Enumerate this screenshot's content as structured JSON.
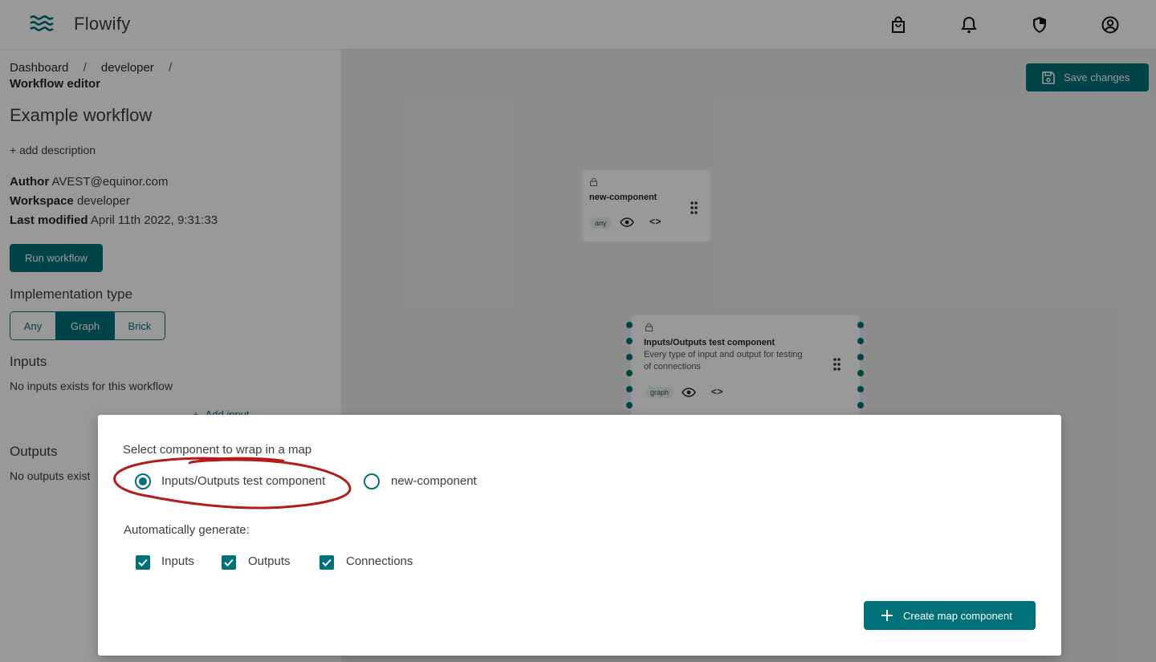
{
  "app": {
    "title": "Flowify"
  },
  "header": {
    "icons": [
      "shopping-bag-icon",
      "bell-icon",
      "shield-icon",
      "account-circle-icon"
    ]
  },
  "breadcrumb": {
    "items": [
      "Dashboard",
      "developer"
    ],
    "separator": "/",
    "current": "Workflow editor"
  },
  "workflow": {
    "title": "Example workflow",
    "add_description": "+ add description",
    "author_label": "Author",
    "author": "AVEST@equinor.com",
    "workspace_label": "Workspace",
    "workspace": "developer",
    "last_modified_label": "Last modified",
    "last_modified": "April 11th 2022, 9:31:33",
    "run_button": "Run workflow"
  },
  "implementation": {
    "title": "Implementation type",
    "options": [
      "Any",
      "Graph",
      "Brick"
    ],
    "selected": "Graph"
  },
  "inputs": {
    "title": "Inputs",
    "empty_text": "No inputs exists for this workflow",
    "add_label": "Add input"
  },
  "outputs": {
    "title": "Outputs",
    "empty_text": "No outputs exist"
  },
  "canvas": {
    "save_button": "Save changes",
    "nodes": [
      {
        "title": "new-component",
        "description": "",
        "tag": "any"
      },
      {
        "title": "Inputs/Outputs test component",
        "description": "Every type of input and output for testing of connections",
        "tag": "graph"
      }
    ]
  },
  "modal": {
    "title": "Select component to wrap in a map",
    "options": [
      "Inputs/Outputs test component",
      "new-component"
    ],
    "selected_option": "Inputs/Outputs test component",
    "auto_generate_label": "Automatically generate:",
    "checkboxes": [
      {
        "label": "Inputs",
        "checked": true
      },
      {
        "label": "Outputs",
        "checked": true
      },
      {
        "label": "Connections",
        "checked": true
      }
    ],
    "create_button": "Create map component"
  },
  "colors": {
    "primary": "#007079",
    "annotation": "#b41b1b",
    "overlay": "rgba(0,0,0,0.4)"
  }
}
